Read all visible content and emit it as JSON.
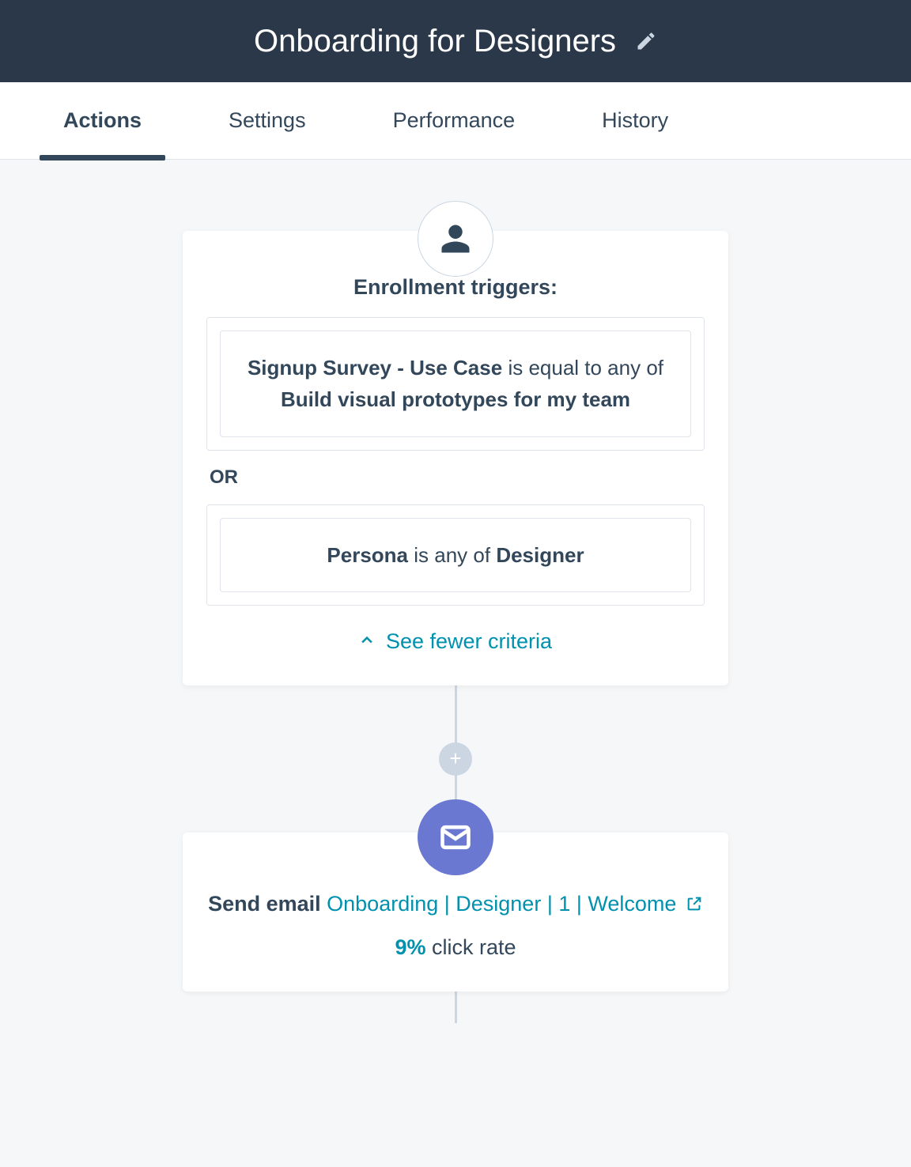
{
  "header": {
    "title": "Onboarding for Designers"
  },
  "tabs": [
    {
      "label": "Actions",
      "active": true
    },
    {
      "label": "Settings",
      "active": false
    },
    {
      "label": "Performance",
      "active": false
    },
    {
      "label": "History",
      "active": false
    }
  ],
  "trigger_card": {
    "heading": "Enrollment triggers:",
    "criteria": [
      {
        "field": "Signup Survey - Use Case",
        "operator": "is equal to any of",
        "value": "Build visual prototypes for my team"
      },
      {
        "field": "Persona",
        "operator": "is any of",
        "value": "Designer"
      }
    ],
    "or_label": "OR",
    "toggle_label": "See fewer criteria"
  },
  "action_card": {
    "prefix": "Send email",
    "email_name": "Onboarding | Designer | 1 | Welcome",
    "stat_value": "9%",
    "stat_label": "click rate"
  },
  "icons": {
    "person": "person-icon",
    "email": "email-icon",
    "edit": "pencil-icon",
    "chevron_up": "chevron-up-icon",
    "external": "external-link-icon",
    "plus": "plus-icon"
  }
}
